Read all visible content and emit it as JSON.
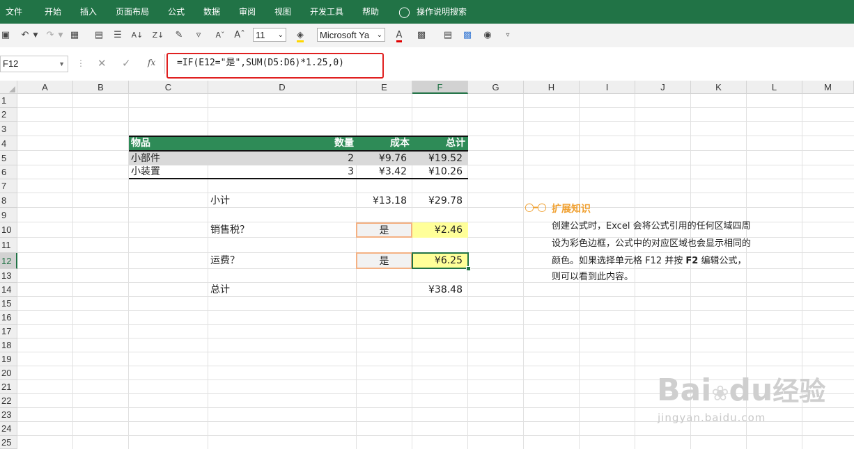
{
  "ribbon": {
    "tabs": [
      "文件",
      "开始",
      "插入",
      "页面布局",
      "公式",
      "数据",
      "审阅",
      "视图",
      "开发工具",
      "帮助"
    ],
    "search_label": "操作说明搜索"
  },
  "toolbar": {
    "font_size": "11",
    "font_name": "Microsoft Ya"
  },
  "formula_bar": {
    "name_box": "F12",
    "formula": "=IF(E12=\"是\",SUM(D5:D6)*1.25,0)",
    "fx_label": "fx"
  },
  "columns": [
    "A",
    "B",
    "C",
    "D",
    "E",
    "F",
    "G",
    "H",
    "I",
    "J",
    "K",
    "L",
    "M"
  ],
  "rows": [
    "1",
    "2",
    "3",
    "4",
    "5",
    "6",
    "7",
    "8",
    "9",
    "10",
    "11",
    "12",
    "13",
    "14",
    "15",
    "16",
    "17",
    "18",
    "19",
    "20",
    "21",
    "22",
    "23",
    "24",
    "25"
  ],
  "table": {
    "headers": {
      "item": "物品",
      "qty": "数量",
      "cost": "成本",
      "total": "总计"
    },
    "rows": [
      {
        "item": "小部件",
        "qty": "2",
        "cost": "¥9.76",
        "total": "¥19.52"
      },
      {
        "item": "小装置",
        "qty": "3",
        "cost": "¥3.42",
        "total": "¥10.26"
      }
    ]
  },
  "summary": {
    "subtotal_label": "小计",
    "subtotal_cost": "¥13.18",
    "subtotal_total": "¥29.78",
    "tax_label": "销售税？",
    "tax_choice": "是",
    "tax_value": "¥2.46",
    "shipping_label": "运费？",
    "shipping_choice": "是",
    "shipping_value": "¥6.25",
    "total_label": "总计",
    "total_value": "¥38.48"
  },
  "tip": {
    "title": "扩展知识",
    "line1": "创建公式时，Excel 会将公式引用的任何区域四周",
    "line2": "设为彩色边框，公式中的对应区域也会显示相同的",
    "line3_a": "颜色。如果选择单元格 F12 并按 ",
    "line3_key": "F2",
    "line3_b": " 编辑公式，",
    "line4": "则可以看到此内容。"
  },
  "watermark": {
    "brand": "Bai",
    "brand2": "du",
    "product": "经验",
    "url": "jingyan.baidu.com"
  },
  "colors": {
    "ribbon": "#217346",
    "header_fill": "#2e8b57",
    "tip_orange": "#f0a030",
    "highlight_yellow": "#ffff99",
    "input_orange": "#f4b183"
  }
}
